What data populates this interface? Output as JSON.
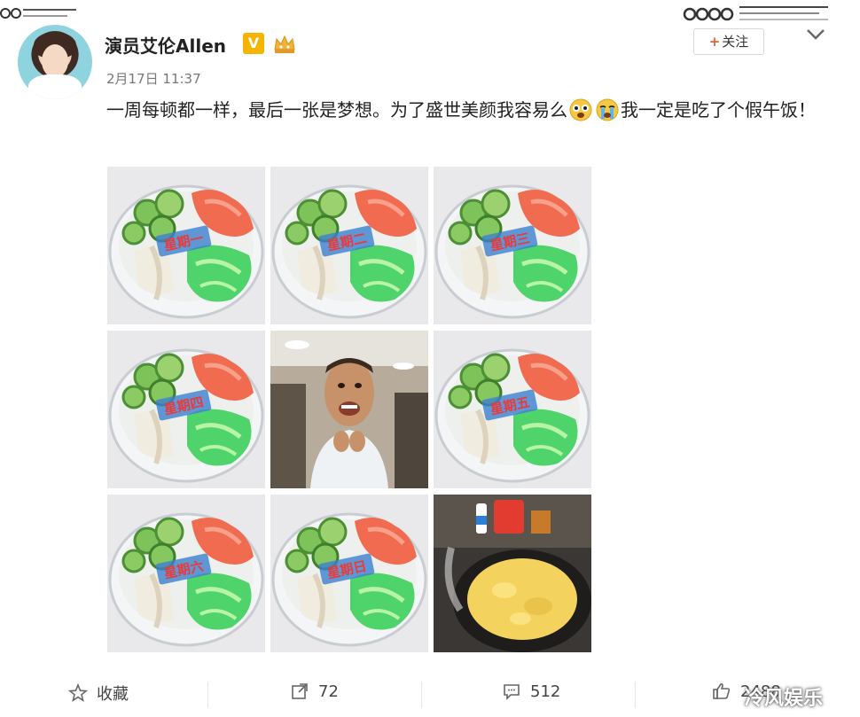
{
  "post": {
    "username": "演员艾伦Allen",
    "verified_badge": "V",
    "timestamp": "2月17日 11:37",
    "follow_label": "关注",
    "text_part1": "一周每顿都一样，最后一张是梦想。为了盛世美颜我容易么",
    "text_part2": "我一定是吃了个假午饭！",
    "images": [
      {
        "kind": "salad",
        "sticker": "星期一"
      },
      {
        "kind": "salad",
        "sticker": "星期二"
      },
      {
        "kind": "salad",
        "sticker": "星期三"
      },
      {
        "kind": "salad",
        "sticker": "星期四"
      },
      {
        "kind": "person"
      },
      {
        "kind": "salad",
        "sticker": "星期五"
      },
      {
        "kind": "salad",
        "sticker": "星期六"
      },
      {
        "kind": "salad",
        "sticker": "星期日"
      },
      {
        "kind": "omelette"
      }
    ]
  },
  "actions": {
    "favorite_label": "收藏",
    "repost_count": "72",
    "comment_count": "512",
    "like_count": "2488"
  },
  "watermark": "冷风娱乐",
  "icons": [
    "crown-icon",
    "chevron-down-icon",
    "star-icon",
    "share-icon",
    "comment-icon",
    "thumbs-up-icon",
    "scared-emoji-icon",
    "crying-emoji-icon"
  ]
}
